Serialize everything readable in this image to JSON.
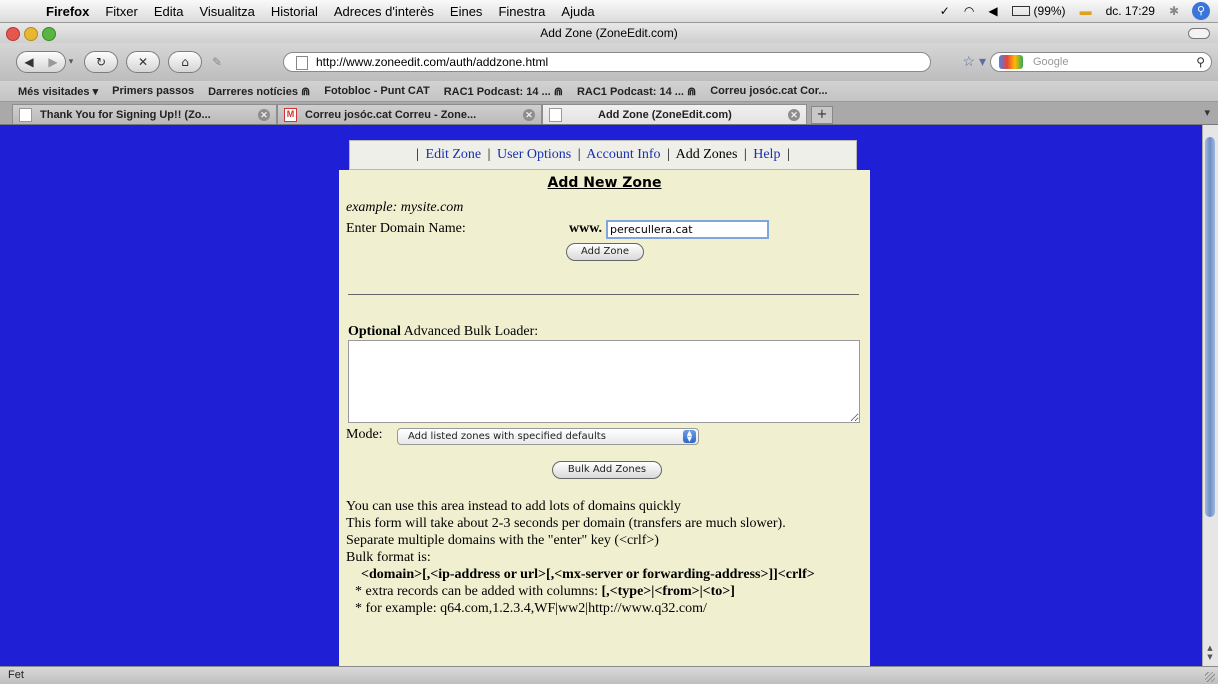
{
  "menubar": {
    "app": "Firefox",
    "items": [
      "Fitxer",
      "Edita",
      "Visualitza",
      "Historial",
      "Adreces d'interès",
      "Eines",
      "Finestra",
      "Ajuda"
    ],
    "battery": "(99%)",
    "clock": "dc. 17:29",
    "icons": [
      "apple-icon",
      "bluetooth-icon",
      "wifi-icon",
      "volume-icon",
      "battery-icon",
      "spotlight-icon"
    ]
  },
  "window": {
    "title": "Add Zone (ZoneEdit.com)"
  },
  "toolbar": {
    "url": "http://www.zoneedit.com/auth/addzone.html",
    "search_placeholder": "Google"
  },
  "bookmarks": [
    "Més visitades ▾",
    "Primers passos",
    "Darreres notícies ⋒",
    "Fotobloc - Punt CAT",
    "RAC1 Podcast: 14 ... ⋒",
    "RAC1 Podcast: 14 ... ⋒",
    "Correu josóc.cat Cor..."
  ],
  "tabs": [
    {
      "label": "Thank You for Signing Up!! (Zo...",
      "active": false
    },
    {
      "label": "Correu josóc.cat Correu - Zone...",
      "active": false
    },
    {
      "label": "Add Zone (ZoneEdit.com)",
      "active": true
    }
  ],
  "nav": {
    "edit_zone": "Edit Zone",
    "user_options": "User Options",
    "account_info": "Account Info",
    "add_zones": "Add Zones",
    "help": "Help",
    "separator": "|"
  },
  "form": {
    "title": "Add New Zone",
    "example": "example: mysite.com",
    "domain_label": "Enter Domain Name:",
    "www": "www.",
    "domain_value": "perecullera.cat",
    "add_zone_button": "Add Zone",
    "optional_bold": "Optional",
    "optional_rest": " Advanced Bulk Loader:",
    "bulk_text": "",
    "mode_label": "Mode:",
    "mode_value": "Add listed zones with specified defaults",
    "bulk_button": "Bulk Add Zones"
  },
  "help": {
    "line1": "You can use this area instead to add lots of domains quickly",
    "line2": "This form will take about 2-3 seconds per domain (transfers are much slower).",
    "line3": "Separate multiple domains with the \"enter\" key (<crlf>)",
    "line4": "Bulk format is:",
    "format": "<domain>[,<ip-address or url>[,<mx-server or forwarding-address>]]<crlf>",
    "extra_prefix": "* extra records can be added with columns: ",
    "extra_bold": "[,<type>|<from>|<to>]",
    "example_line": "* for example: q64.com,1.2.3.4,WF|ww2|http://www.q32.com/"
  },
  "status": {
    "text": "Fet"
  },
  "colors": {
    "page_bg": "#1f1fd6",
    "panel_bg": "#f0efd0",
    "link": "#1a2fb0"
  }
}
